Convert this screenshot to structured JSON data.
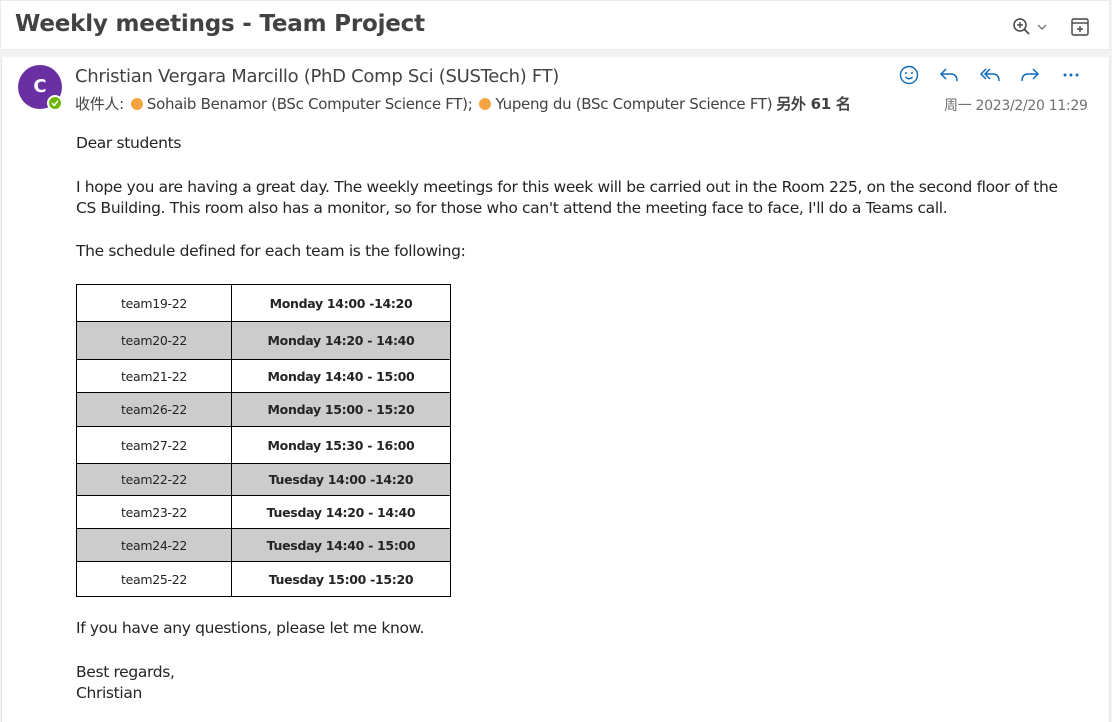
{
  "subject": "Weekly meetings - Team Project",
  "sender": {
    "avatar_initial": "C",
    "name": "Christian Vergara Marcillo (PhD Comp Sci (SUSTech) FT)"
  },
  "recipients": {
    "label": "收件人:",
    "list": [
      "Sohaib Benamor (BSc Computer Science FT);",
      "Yupeng du (BSc Computer Science FT)"
    ],
    "more": "另外 61 名"
  },
  "date": "周一 2023/2/20 11:29",
  "body": {
    "greeting": "Dear students",
    "para1": "I hope you are having a great day. The weekly meetings for this week will be carried out in the Room 225, on the second floor of the CS Building. This room also has a monitor, so for those who can't attend the meeting face to face, I'll do a Teams call.",
    "para2": "The schedule defined for each team is the following:",
    "para3": "If you have any questions, please let me know.",
    "closing": "Best regards,",
    "signature": "Christian"
  },
  "schedule": [
    {
      "team": "team19-22",
      "time": "Monday 14:00 -14:20"
    },
    {
      "team": "team20-22",
      "time": "Monday 14:20 - 14:40"
    },
    {
      "team": "team21-22",
      "time": "Monday 14:40 - 15:00"
    },
    {
      "team": "team26-22",
      "time": "Monday 15:00 - 15:20"
    },
    {
      "team": "team27-22",
      "time": "Monday 15:30 - 16:00"
    },
    {
      "team": "team22-22",
      "time": "Tuesday 14:00 -14:20"
    },
    {
      "team": "team23-22",
      "time": "Tuesday 14:20 - 14:40"
    },
    {
      "team": "team24-22",
      "time": "Tuesday 14:40 - 15:00"
    },
    {
      "team": "team25-22",
      "time": "Tuesday 15:00 -15:20"
    }
  ],
  "icons": {
    "zoom": "zoom-in-icon",
    "popout": "open-in-new-window-icon",
    "emoji": "smiley-icon",
    "reply": "reply-icon",
    "reply_all": "reply-all-icon",
    "forward": "forward-icon",
    "more": "more-icon"
  },
  "colors": {
    "accent": "#0f6cbd",
    "avatar": "#6b2fa4",
    "presence": "#6bb700",
    "recipient_dot": "#f5a441",
    "row_shade": "#cccccc"
  }
}
